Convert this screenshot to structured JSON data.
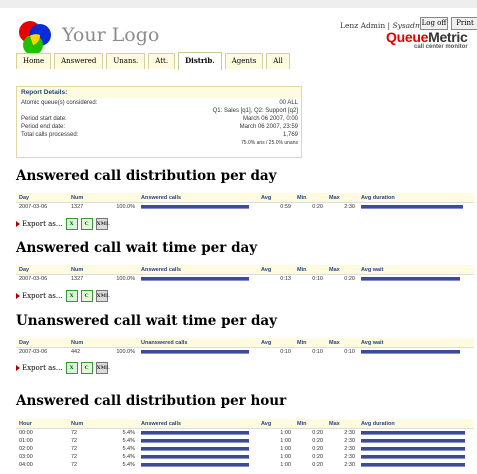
{
  "header": {
    "logo_text": "Your Logo",
    "user_prefix": "Lenz Admin | ",
    "user_role": "Sysadmin",
    "logoff_label": "Log off",
    "print_label": "Print",
    "product_q": "Queue",
    "product_m": "Metric",
    "product_sub": "call center monitor"
  },
  "tabs": [
    "Home",
    "Answered",
    "Unans.",
    "Att.",
    "Distrib.",
    "Agents",
    "All"
  ],
  "active_tab": "Distrib.",
  "report": {
    "title": "Report Details:",
    "queues_label": "Atomic queue(s) considered:",
    "queues_value": "00 ALL",
    "queues_detail": "Q1: Sales [q1], Q2: Support [q2]",
    "start_label": "Period start date:",
    "start_value": "March 06 2007, 0:00",
    "end_label": "Period end date:",
    "end_value": "March 06 2007, 23:59",
    "total_label": "Total calls processed:",
    "total_value": "1,769",
    "total_sub": "75.0% ans / 25.0% unans"
  },
  "export_label": "Export as...",
  "sections": {
    "s1": {
      "title": "Answered call distribution per day",
      "headers": [
        "Day",
        "Num",
        "",
        "Answered calls",
        "Avg",
        "Min",
        "Max",
        "Avg duration"
      ],
      "rows": [
        [
          "2007-03-06",
          "1327",
          "100.0%",
          "",
          "0:59",
          "0:20",
          "2:30"
        ]
      ],
      "bars": [
        1.0
      ],
      "bars2": [
        0.98
      ]
    },
    "s2": {
      "title": "Answered call wait time per day",
      "headers": [
        "Day",
        "Num",
        "",
        "Answered calls",
        "Avg",
        "Min",
        "Max",
        "Avg wait"
      ],
      "rows": [
        [
          "2007-03-06",
          "1327",
          "100.0%",
          "",
          "0:13",
          "0:10",
          "0:20"
        ]
      ],
      "bars": [
        1.0
      ],
      "bars2": [
        0.95
      ]
    },
    "s3": {
      "title": "Unanswered call wait time per day",
      "headers": [
        "Day",
        "Num",
        "",
        "Unanswered calls",
        "Avg",
        "Min",
        "Max",
        "Avg wait"
      ],
      "rows": [
        [
          "2007-03-06",
          "442",
          "100.0%",
          "",
          "0:10",
          "0:10",
          "0:10"
        ]
      ],
      "bars": [
        1.0
      ],
      "bars2": [
        0.95
      ]
    },
    "s4": {
      "title": "Answered call distribution per hour",
      "headers": [
        "Hour",
        "Num",
        "",
        "Answered calls",
        "Avg",
        "Min",
        "Max",
        "Avg duration"
      ],
      "rows": [
        [
          "00:00",
          "72",
          "5.4%",
          "",
          "1:00",
          "0:20",
          "2:30"
        ],
        [
          "01:00",
          "72",
          "5.4%",
          "",
          "1:00",
          "0:20",
          "2:30"
        ],
        [
          "02:00",
          "72",
          "5.4%",
          "",
          "1:00",
          "0:20",
          "2:30"
        ],
        [
          "03:00",
          "72",
          "5.4%",
          "",
          "1:00",
          "0:20",
          "2:30"
        ],
        [
          "04:00",
          "72",
          "5.4%",
          "",
          "1:00",
          "0:20",
          "2:30"
        ]
      ],
      "bars": [
        1.0,
        1.0,
        1.0,
        1.0,
        1.0
      ],
      "bars2": [
        1.0,
        1.0,
        1.0,
        1.0,
        1.0
      ]
    }
  },
  "icons": [
    "logo-circles-icon",
    "arrow-right-icon",
    "excel-icon",
    "csv-icon",
    "xml-icon"
  ]
}
